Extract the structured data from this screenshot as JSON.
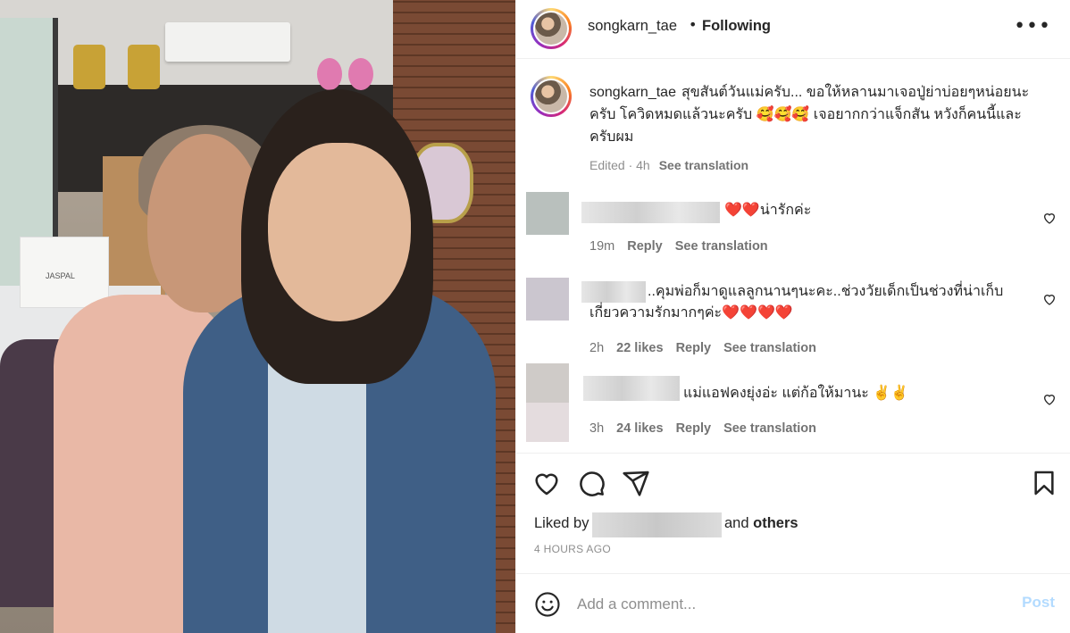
{
  "post": {
    "author": "songkarn_tae",
    "follow_separator": "•",
    "follow_label": "Following",
    "more_icon": "more-horizontal-icon",
    "photo_bag_text": "JASPAL"
  },
  "caption": {
    "username": "songkarn_tae",
    "text": "สุขสันต์วันแม่ครับ... ขอให้หลานมาเจอปู่ย่าบ่อยๆหน่อยนะครับ โควิดหมดแล้วนะครับ 🥰🥰🥰 เจอยากกว่าแจ็กสัน หวังก็คนนี้และครับผม",
    "edited": "Edited · 4h",
    "see_translation": "See translation"
  },
  "comments": [
    {
      "text": "❤️❤️น่ารักค่ะ",
      "time": "19m",
      "likes": "",
      "reply": "Reply",
      "see_translation": "See translation"
    },
    {
      "text": "..คุมพ่อก็มาดูแลลูกนานๆนะคะ..ช่วงวัยเด็กเป็นช่วงที่น่าเก็บเกี่ยวความรักมากๆค่ะ❤️❤️❤️❤️",
      "time": "2h",
      "likes": "22 likes",
      "reply": "Reply",
      "see_translation": "See translation"
    },
    {
      "text": "แม่แอฟคงยุ่งอ่ะ แต่ก้อให้มานะ ✌️✌️",
      "time": "3h",
      "likes": "24 likes",
      "reply": "Reply",
      "see_translation": "See translation"
    }
  ],
  "actions": {
    "like_icon": "heart-icon",
    "comment_icon": "comment-icon",
    "share_icon": "share-icon",
    "save_icon": "bookmark-icon"
  },
  "likes": {
    "prefix": "Liked by",
    "and": "and",
    "others": "others"
  },
  "timestamp": "4 HOURS AGO",
  "add_comment": {
    "placeholder": "Add a comment...",
    "post_label": "Post",
    "emoji_icon": "smile-icon"
  },
  "colors": {
    "post_button_disabled": "#b3dbff",
    "secondary_text": "#737373"
  }
}
